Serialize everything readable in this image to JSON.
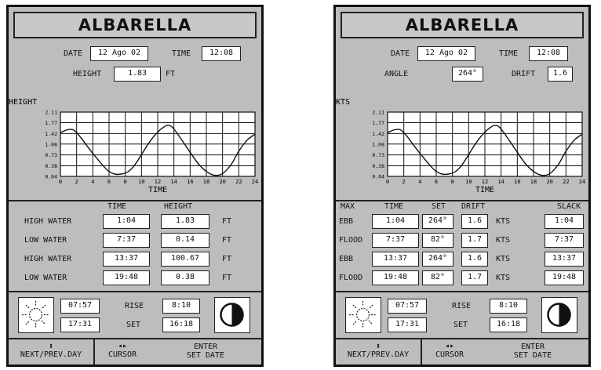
{
  "left": {
    "title": "ALBARELLA",
    "date_label": "DATE",
    "date_value": "12 Ago 02",
    "time_label": "TIME",
    "time_value": "12:08",
    "height_label": "HEIGHT",
    "height_value": "1.83",
    "height_unit": "FT",
    "chart_ylabel": "HEIGHT",
    "chart_xlabel": "TIME",
    "yticks": [
      "2.11",
      "1.77",
      "1.42",
      "1.08",
      "0.73",
      "0.38",
      "0.04"
    ],
    "xticks": [
      "0",
      "2",
      "4",
      "6",
      "8",
      "10",
      "12",
      "14",
      "16",
      "18",
      "20",
      "22",
      "24"
    ],
    "col_time": "TIME",
    "col_height": "HEIGHT",
    "rows": [
      {
        "label": "HIGH WATER",
        "time": "1:04",
        "height": "1.83",
        "unit": "FT"
      },
      {
        "label": "LOW WATER",
        "time": "7:37",
        "height": "0.14",
        "unit": "FT"
      },
      {
        "label": "HIGH WATER",
        "time": "13:37",
        "height": "100.67",
        "unit": "FT"
      },
      {
        "label": "LOW WATER",
        "time": "19:48",
        "height": "0.38",
        "unit": "FT"
      }
    ],
    "sun_top": "07:57",
    "sun_bottom": "17:31",
    "rise_label": "RISE",
    "rise_value": "8:10",
    "set_label": "SET",
    "set_value": "16:18"
  },
  "right": {
    "title": "ALBARELLA",
    "date_label": "DATE",
    "date_value": "12 Ago 02",
    "time_label": "TIME",
    "time_value": "12:08",
    "angle_label": "ANGLE",
    "angle_value": "264°",
    "drift_label": "DRIFT",
    "drift_value": "1.6",
    "chart_ylabel": "KTS",
    "chart_xlabel": "TIME",
    "yticks": [
      "2.11",
      "1.77",
      "1.42",
      "1.08",
      "0.73",
      "0.38",
      "0.04"
    ],
    "xticks": [
      "0",
      "2",
      "4",
      "6",
      "8",
      "10",
      "12",
      "14",
      "16",
      "18",
      "20",
      "22",
      "24"
    ],
    "col_max": "MAX",
    "col_time": "TIME",
    "col_set": "SET",
    "col_drift": "DRIFT",
    "col_slack": "SLACK",
    "rows": [
      {
        "label": "EBB",
        "time": "1:04",
        "set": "264°",
        "drift": "1.6",
        "unit": "KTS",
        "slack": "1:04"
      },
      {
        "label": "FLOOD",
        "time": "7:37",
        "set": "82°",
        "drift": "1.7",
        "unit": "KTS",
        "slack": "7:37"
      },
      {
        "label": "EBB",
        "time": "13:37",
        "set": "264°",
        "drift": "1.6",
        "unit": "KTS",
        "slack": "13:37"
      },
      {
        "label": "FLOOD",
        "time": "19:48",
        "set": "82°",
        "drift": "1.7",
        "unit": "KTS",
        "slack": "19:48"
      }
    ],
    "sun_top": "07:57",
    "sun_bottom": "17:31",
    "rise_label": "RISE",
    "rise_value": "8:10",
    "set_label": "SET",
    "set_value": "16:18"
  },
  "footer": {
    "nav_symbol": "⬍",
    "nav_label": "NEXT/PREV.DAY",
    "cursor_symbol": "◂▸",
    "cursor_label": "CURSOR",
    "enter_label": "ENTER",
    "setdate_label": "SET DATE"
  },
  "chart_data": [
    {
      "type": "line",
      "title": "",
      "ylabel": "HEIGHT",
      "xlabel": "TIME",
      "xlim": [
        0,
        24
      ],
      "ylim": [
        0.04,
        2.11
      ],
      "x": [
        0,
        1.07,
        2,
        4,
        6,
        7.62,
        9,
        11,
        12.5,
        13.62,
        15,
        17,
        18.5,
        19.8,
        21,
        22,
        23,
        24
      ],
      "y": [
        1.45,
        1.55,
        1.45,
        0.78,
        0.2,
        0.12,
        0.35,
        1.15,
        1.58,
        1.66,
        1.2,
        0.45,
        0.12,
        0.1,
        0.4,
        0.85,
        1.2,
        1.4
      ]
    },
    {
      "type": "line",
      "title": "",
      "ylabel": "KTS",
      "xlabel": "TIME",
      "xlim": [
        0,
        24
      ],
      "ylim": [
        0.04,
        2.11
      ],
      "x": [
        0,
        1.07,
        2,
        4,
        6,
        7.62,
        9,
        11,
        12.5,
        13.62,
        15,
        17,
        18.5,
        19.8,
        21,
        22,
        23,
        24
      ],
      "y": [
        1.45,
        1.55,
        1.45,
        0.78,
        0.2,
        0.12,
        0.35,
        1.15,
        1.58,
        1.66,
        1.2,
        0.45,
        0.12,
        0.1,
        0.4,
        0.85,
        1.2,
        1.4
      ]
    }
  ]
}
